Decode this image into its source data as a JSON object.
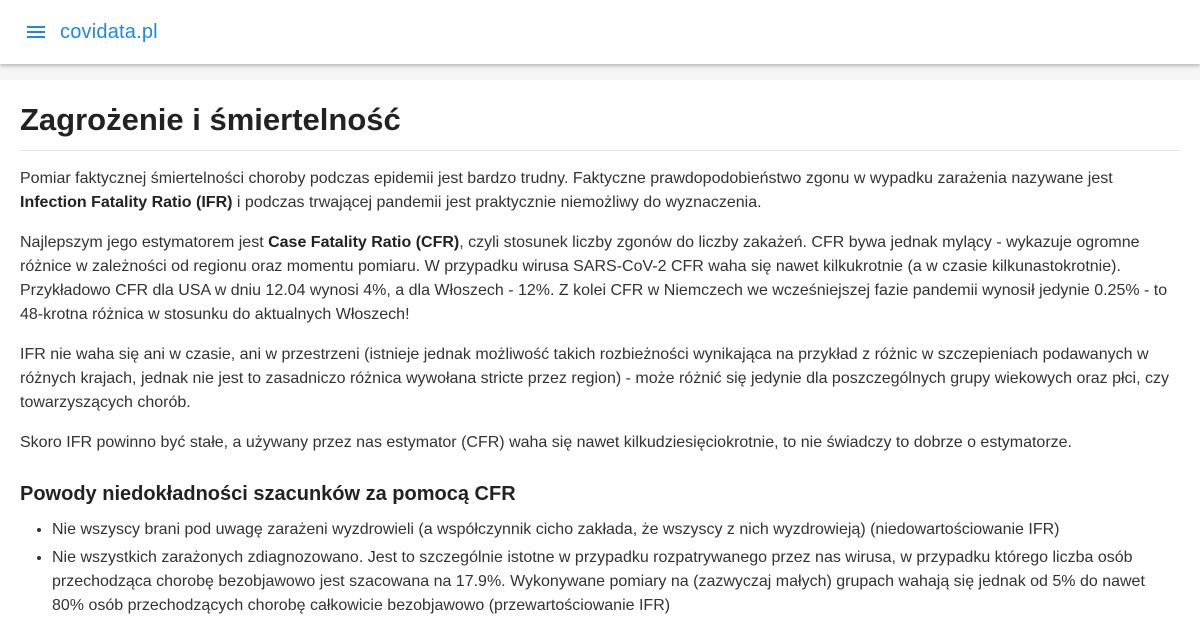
{
  "header": {
    "brand": "covidata.pl",
    "menu_icon": "hamburger-menu-icon",
    "accent_color": "#1e88e5"
  },
  "article": {
    "title": "Zagrożenie i śmiertelność",
    "p1": {
      "text_a": "Pomiar faktycznej śmiertelności choroby podczas epidemii jest bardzo trudny. Faktyczne prawdopodobieństwo zgonu w wypadku zarażenia nazywane jest ",
      "bold": "Infection Fatality Ratio (IFR)",
      "text_b": " i podczas trwającej pandemii jest praktycznie niemożliwy do wyznaczenia."
    },
    "p2": {
      "text_a": "Najlepszym jego estymatorem jest ",
      "bold": "Case Fatality Ratio (CFR)",
      "text_b": ", czyli stosunek liczby zgonów do liczby zakażeń. CFR bywa jednak mylący - wykazuje ogromne różnice w zależności od regionu oraz momentu pomiaru. W przypadku wirusa SARS-CoV-2 CFR waha się nawet kilkukrotnie (a w czasie kilkunastokrotnie). Przykładowo CFR dla USA w dniu 12.04 wynosi 4%, a dla Włoszech - 12%. Z kolei CFR w Niemczech we wcześniejszej fazie pandemii wynosił jedynie 0.25% - to 48-krotna różnica w stosunku do aktualnych Włoszech!"
    },
    "p3": "IFR nie waha się ani w czasie, ani w przestrzeni (istnieje jednak możliwość takich rozbieżności wynikająca na przykład z różnic w szczepieniach podawanych w różnych krajach, jednak nie jest to zasadniczo różnica wywołana stricte przez region) - może różnić się jedynie dla poszczególnych grupy wiekowych oraz płci, czy towarzyszących chorób.",
    "p4": "Skoro IFR powinno być stałe, a używany przez nas estymator (CFR) waha się nawet kilkudziesięciokrotnie, to nie świadczy to dobrze o estymatorze.",
    "subtitle": "Powody niedokładności szacunków za pomocą CFR",
    "reasons": [
      "Nie wszyscy brani pod uwagę zarażeni wyzdrowieli (a współczynnik cicho zakłada, że wszyscy z nich wyzdrowieją) (niedowartościowanie IFR)",
      "Nie wszystkich zarażonych zdiagnozowano. Jest to szczególnie istotne w przypadku rozpatrywanego przez nas wirusa, w przypadku którego liczba osób przechodząca chorobę bezobjawowo jest szacowana na 17.9%. Wykonywane pomiary na (zazwyczaj małych) grupach wahają się jednak od 5% do nawet 80% osób przechodzących chorobę całkowicie bezobjawowo (przewartościowanie IFR)"
    ]
  }
}
